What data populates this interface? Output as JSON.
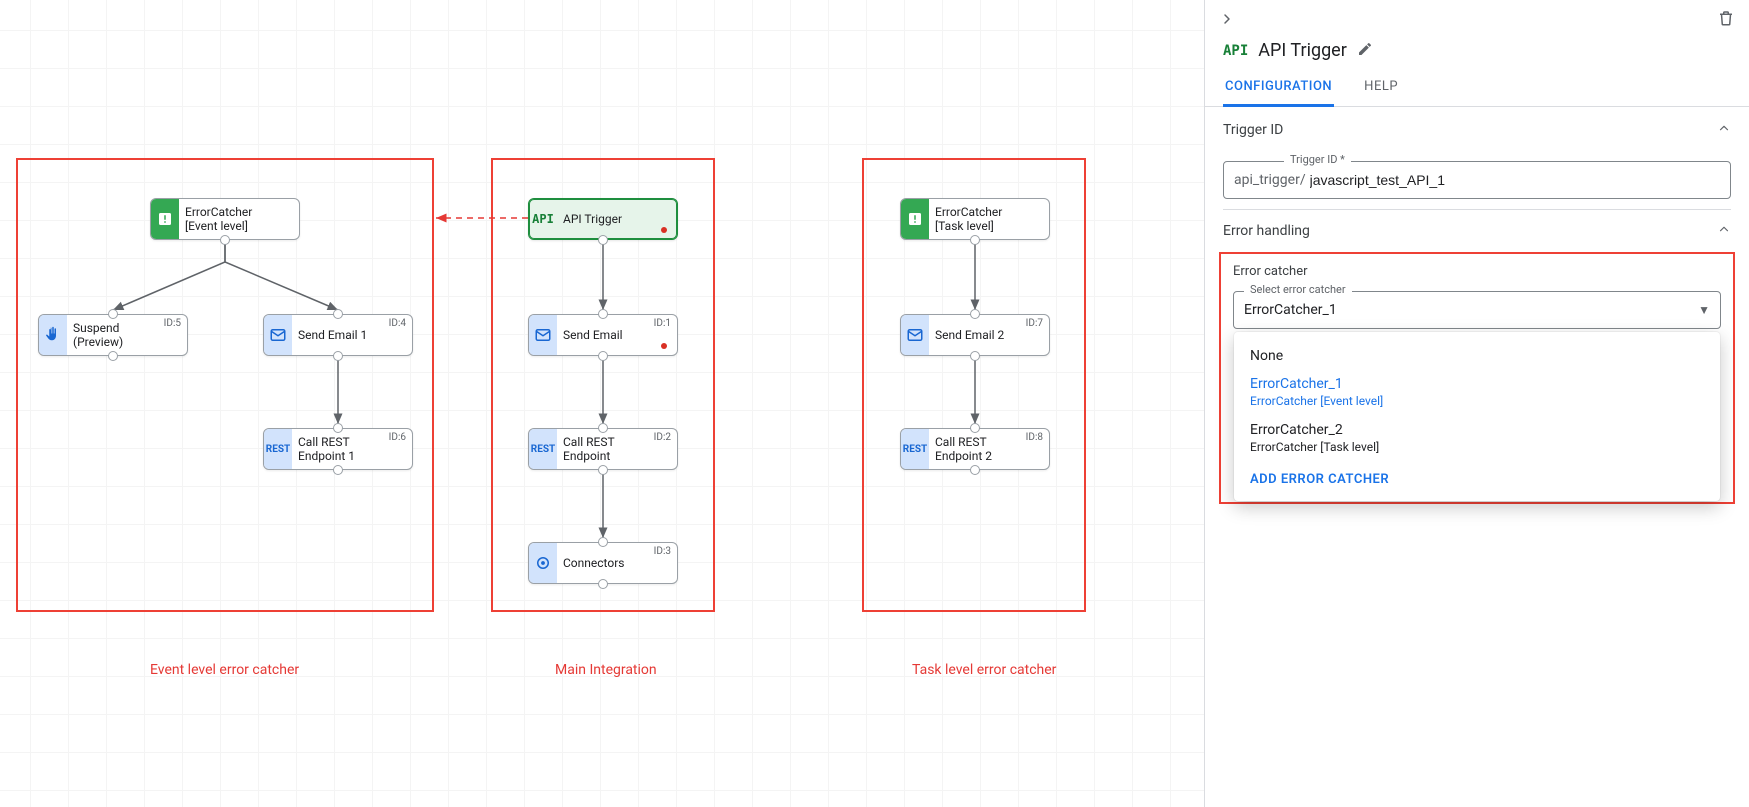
{
  "canvas": {
    "regions": {
      "event": {
        "label": "Event level error catcher"
      },
      "main": {
        "label": "Main Integration"
      },
      "task": {
        "label": "Task level error catcher"
      }
    },
    "nodes": {
      "ec_event": {
        "label": "ErrorCatcher\n[Event level]"
      },
      "suspend": {
        "label": "Suspend\n(Preview)",
        "id": "ID:5"
      },
      "email1": {
        "label": "Send Email 1",
        "id": "ID:4"
      },
      "rest1": {
        "label": "Call REST\nEndpoint 1",
        "id": "ID:6"
      },
      "api": {
        "label": "API Trigger"
      },
      "email": {
        "label": "Send Email",
        "id": "ID:1"
      },
      "rest": {
        "label": "Call REST\nEndpoint",
        "id": "ID:2"
      },
      "connectors": {
        "label": "Connectors",
        "id": "ID:3"
      },
      "ec_task": {
        "label": "ErrorCatcher\n[Task level]"
      },
      "email2": {
        "label": "Send Email 2",
        "id": "ID:7"
      },
      "rest2": {
        "label": "Call REST\nEndpoint 2",
        "id": "ID:8"
      }
    }
  },
  "sidebar": {
    "title": "API Trigger",
    "api_badge": "API",
    "tabs": {
      "config": "CONFIGURATION",
      "help": "HELP"
    },
    "trigger_section": {
      "header": "Trigger ID",
      "field_label": "Trigger ID *",
      "prefix": "api_trigger/",
      "value": "javascript_test_API_1"
    },
    "error_section": {
      "header": "Error handling",
      "sublabel": "Error catcher",
      "select_label": "Select error catcher",
      "selected": "ErrorCatcher_1",
      "options": {
        "none": {
          "title": "None"
        },
        "opt1": {
          "title": "ErrorCatcher_1",
          "sub": "ErrorCatcher [Event level]"
        },
        "opt2": {
          "title": "ErrorCatcher_2",
          "sub": "ErrorCatcher [Task level]"
        }
      },
      "add": "ADD ERROR CATCHER"
    }
  }
}
